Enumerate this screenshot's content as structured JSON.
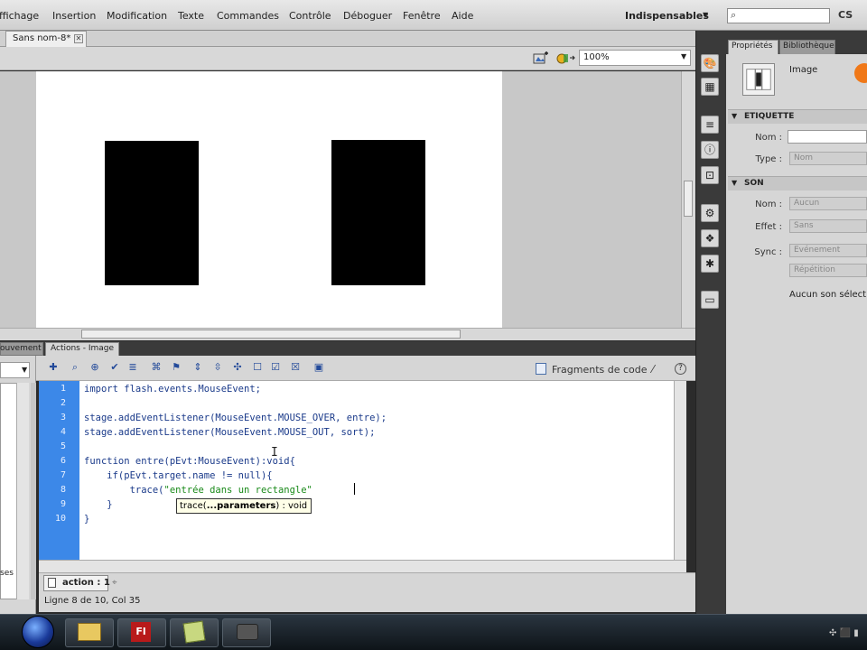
{
  "menubar": {
    "items": [
      "ffichage",
      "Insertion",
      "Modification",
      "Texte",
      "Commandes",
      "Contrôle",
      "Déboguer",
      "Fenêtre",
      "Aide"
    ],
    "workspace": "Indispensables",
    "search_placeholder": "",
    "cs_label": "CS"
  },
  "document": {
    "tab_label": "Sans nom-8*",
    "zoom": "100%"
  },
  "properties": {
    "tabs": [
      "Propriétés",
      "Bibliothèque"
    ],
    "kind": "Image",
    "etiquette": {
      "heading": "ETIQUETTE",
      "nom_label": "Nom :",
      "nom_value": "",
      "type_label": "Type :",
      "type_value": "Nom"
    },
    "son": {
      "heading": "SON",
      "nom_label": "Nom :",
      "nom_value": "Aucun",
      "effet_label": "Effet :",
      "effet_value": "Sans",
      "sync_label": "Sync :",
      "sync_value": "Evénement",
      "repeat_value": "Répétition",
      "status": "Aucun son sélection"
    }
  },
  "actions": {
    "tabs": [
      "ouvement",
      "Actions - Image"
    ],
    "snippets_label": "Fragments de code",
    "left_label": "ses",
    "code_lines": [
      {
        "n": "1",
        "text": "import flash.events.MouseEvent;"
      },
      {
        "n": "2",
        "text": ""
      },
      {
        "n": "3",
        "text": "stage.addEventListener(MouseEvent.MOUSE_OVER, entre);"
      },
      {
        "n": "4",
        "text": "stage.addEventListener(MouseEvent.MOUSE_OUT, sort);"
      },
      {
        "n": "5",
        "text": ""
      },
      {
        "n": "6",
        "text": "function entre(pEvt:MouseEvent):void{"
      },
      {
        "n": "7",
        "text": "    if(pEvt.target.name != null){"
      },
      {
        "n": "8",
        "text_pre": "        trace(",
        "text_str": "\"entrée dans un rectangle\""
      },
      {
        "n": "9",
        "text": "    }"
      },
      {
        "n": "10",
        "text": "}"
      }
    ],
    "tooltip_pre": "trace(",
    "tooltip_bold": "...parameters",
    "tooltip_post": ") : void",
    "script_tab": "action : 1",
    "status": "Ligne 8 de 10, Col 35"
  },
  "colors": {
    "gutter": "#3c88e8",
    "code_text": "#1a3a8a",
    "string": "#1a8a1a"
  }
}
